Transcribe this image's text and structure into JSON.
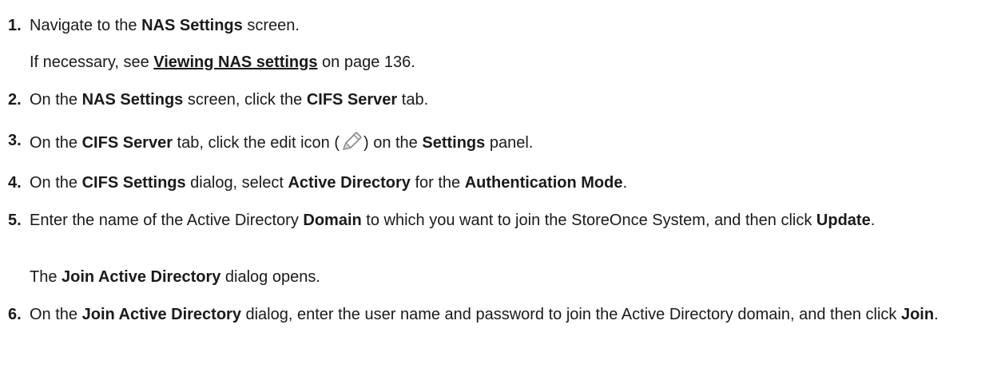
{
  "steps": [
    {
      "n": "1.",
      "parts": [
        "Navigate to the ",
        "NAS Settings",
        " screen."
      ]
    },
    {
      "n": "2.",
      "parts": [
        "On the ",
        "NAS Settings",
        " screen, click the ",
        "CIFS Server",
        " tab."
      ]
    },
    {
      "n": "3.",
      "parts": [
        "On the ",
        "CIFS Server",
        " tab, click the edit icon (",
        ") on the ",
        "Settings",
        " panel."
      ]
    },
    {
      "n": "4.",
      "parts": [
        "On the ",
        "CIFS Settings",
        " dialog, select ",
        "Active Directory",
        " for the ",
        "Authentication Mode",
        "."
      ]
    },
    {
      "n": "5.",
      "parts": [
        "Enter the name of the Active Directory ",
        "Domain",
        " to which you want to join the StoreOnce System, and then click ",
        "Update",
        "."
      ]
    },
    {
      "n": "6.",
      "parts": [
        "On the ",
        "Join Active Directory",
        " dialog, enter the user name and password to join the Active Directory domain, and then click ",
        "Join",
        "."
      ]
    }
  ],
  "notes": {
    "step1": {
      "before": "If necessary, see ",
      "link": "Viewing NAS settings",
      "after": " on page 136."
    },
    "step5": {
      "bold": "Join Active Directory",
      "after": " dialog opens.",
      "before": "The "
    }
  },
  "icons": {
    "edit": "pencil-icon"
  }
}
